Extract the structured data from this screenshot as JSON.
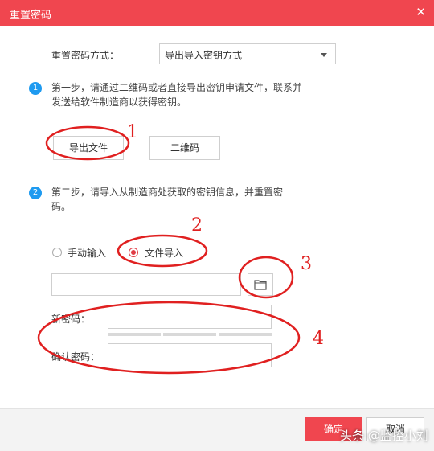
{
  "window": {
    "title": "重置密码",
    "close_icon": "close-icon"
  },
  "method": {
    "label": "重置密码方式：",
    "selected": "导出导入密钥方式"
  },
  "step1": {
    "badge": "1",
    "text": "第一步，请通过二维码或者直接导出密钥申请文件，联系并发送给软件制造商以获得密钥。",
    "export_label": "导出文件",
    "qr_label": "二维码"
  },
  "step2": {
    "badge": "2",
    "text": "第二步，请导入从制造商处获取的密钥信息，并重置密码。",
    "manual_label": "手动输入",
    "file_label": "文件导入",
    "selected": "文件导入"
  },
  "file": {
    "path_value": "",
    "browse_icon": "folder-icon"
  },
  "password": {
    "new_label": "新密码：",
    "new_value": "",
    "confirm_label": "确认密码：",
    "confirm_value": ""
  },
  "footer": {
    "ok_label": "确定",
    "cancel_label": "取消"
  },
  "annotations": {
    "a1": "1",
    "a2": "2",
    "a3": "3",
    "a4": "4"
  },
  "watermark": "头条 @监控小刘",
  "colors": {
    "accent": "#f0464f",
    "step_badge": "#1e9af0",
    "annotation": "#e02020"
  }
}
